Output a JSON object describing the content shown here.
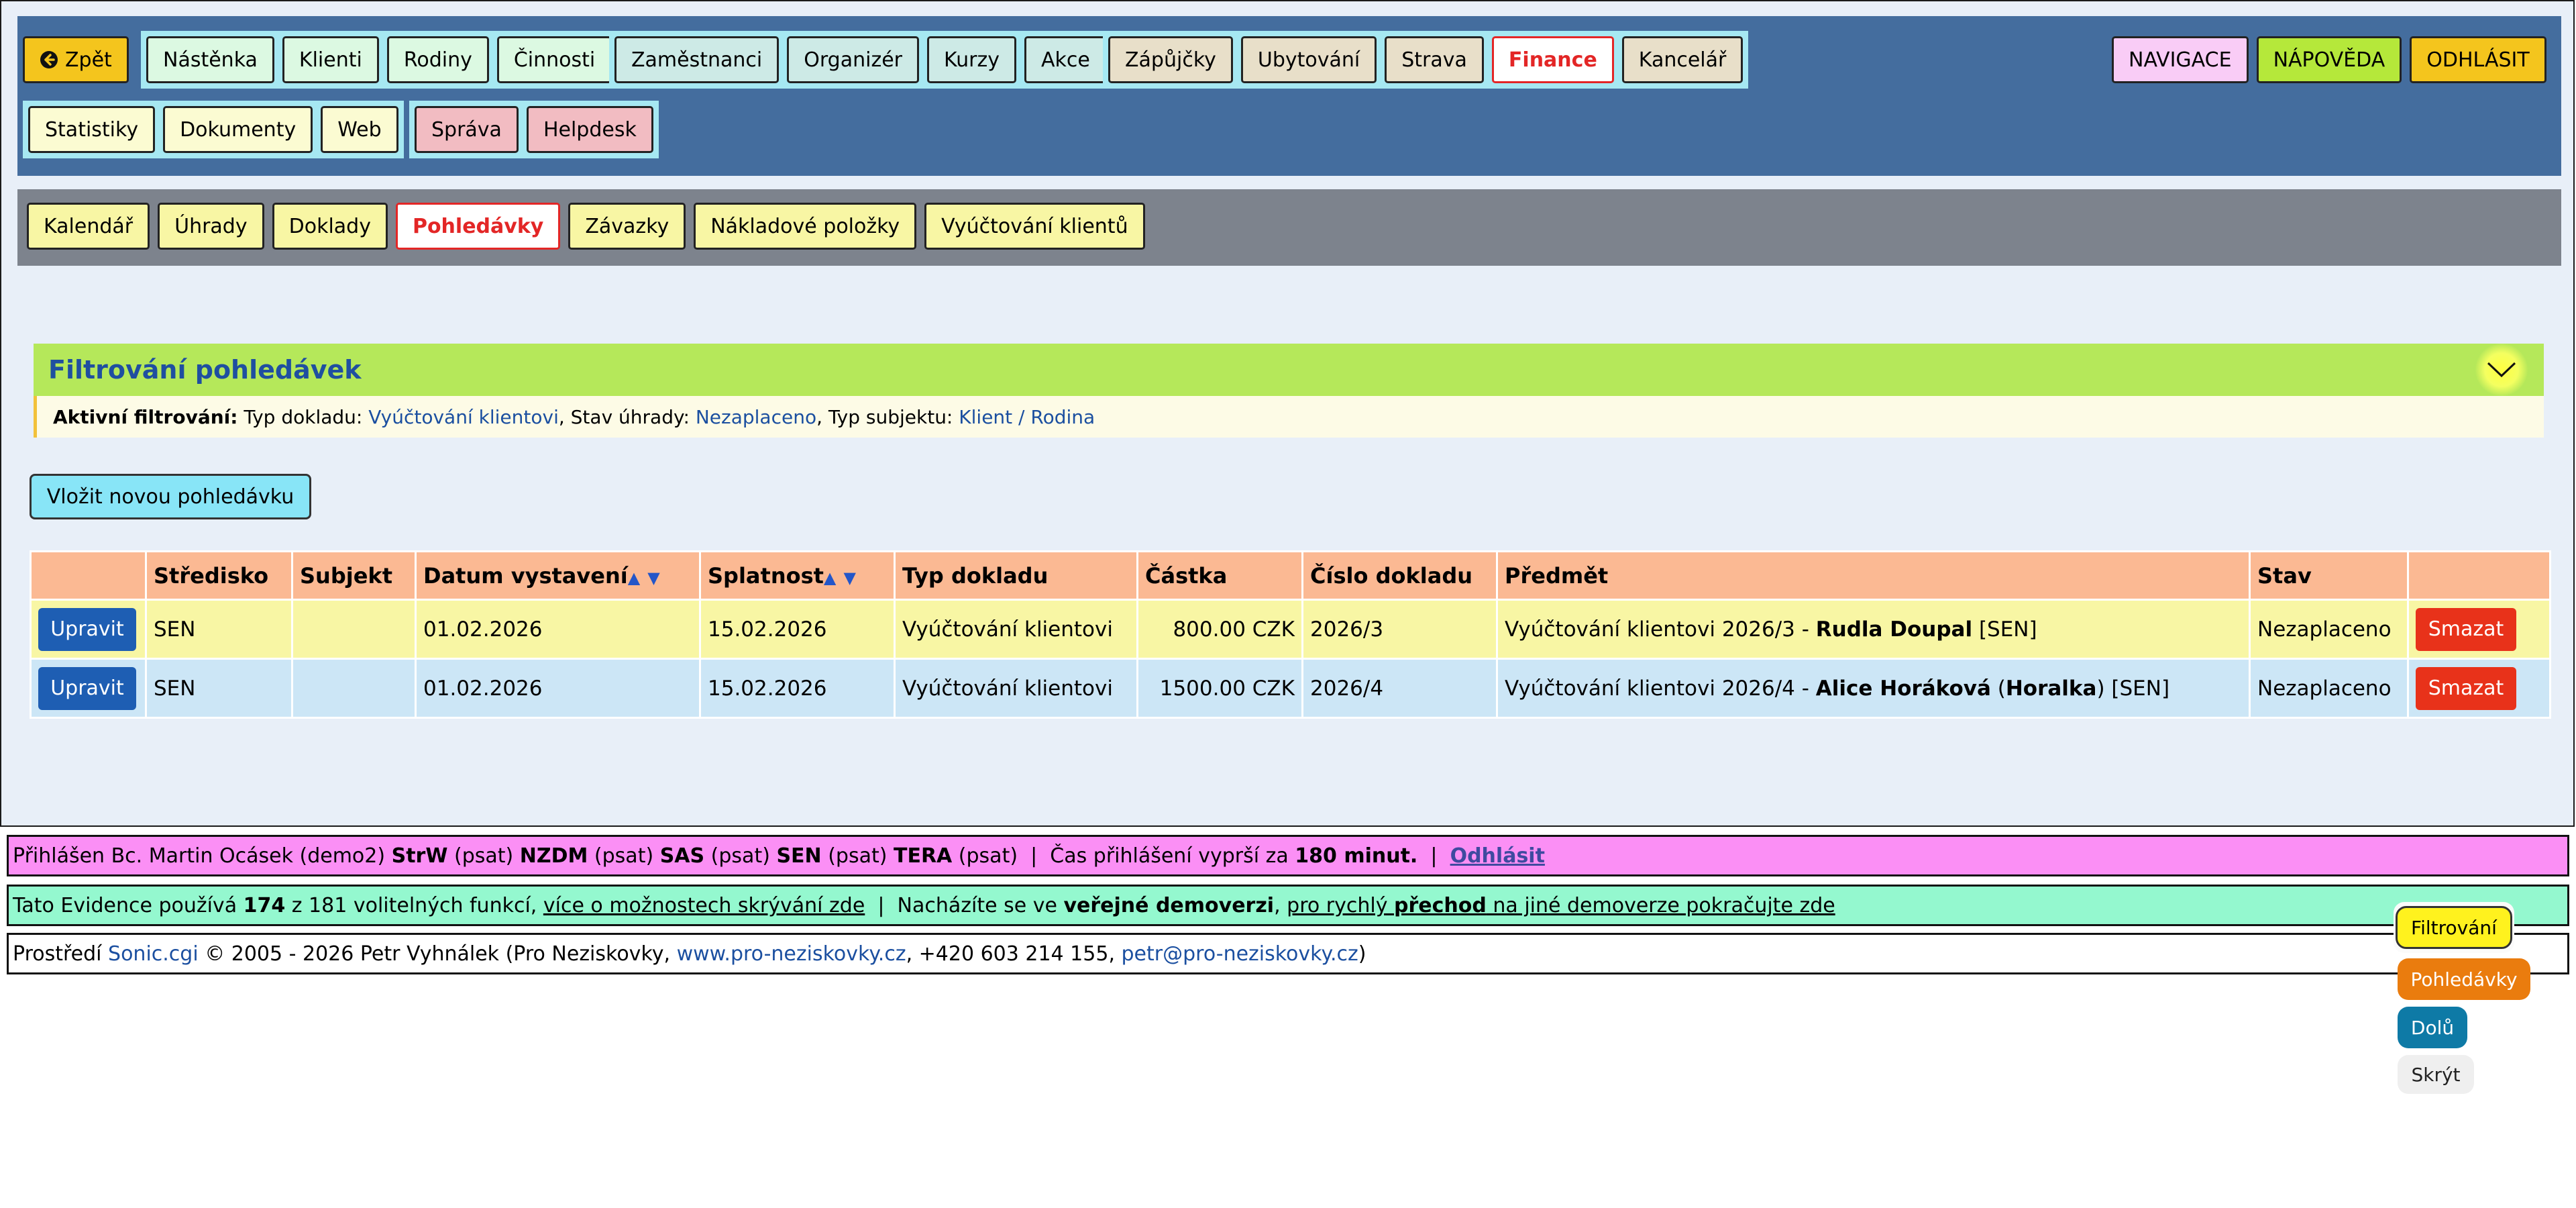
{
  "nav": {
    "back": "Zpět",
    "group1": [
      "Nástěnka",
      "Klienti",
      "Rodiny",
      "Činnosti"
    ],
    "group2": [
      "Zaměstnanci",
      "Organizér",
      "Kurzy",
      "Akce"
    ],
    "group3": [
      "Zápůjčky",
      "Ubytování",
      "Strava",
      "Finance",
      "Kancelář"
    ],
    "group4": [
      "Statistiky",
      "Dokumenty",
      "Web"
    ],
    "group5": [
      "Správa",
      "Helpdesk"
    ],
    "right": [
      "NAVIGACE",
      "NÁPOVĚDA",
      "ODHLÁSIT"
    ]
  },
  "subnav": [
    "Kalendář",
    "Úhrady",
    "Doklady",
    "Pohledávky",
    "Závazky",
    "Nákladové položky",
    "Vyúčtování klientů"
  ],
  "filter": {
    "title": "Filtrování pohledávek",
    "active_label": "Aktivní filtrování:",
    "parts": {
      "t1": " Typ dokladu: ",
      "v1": "Vyúčtování klientovi",
      "t2": ", Stav úhrady: ",
      "v2": "Nezaplaceno",
      "t3": ", Typ subjektu: ",
      "v3": "Klient / Rodina"
    }
  },
  "new_button": "Vložit novou pohledávku",
  "table": {
    "headers": [
      "",
      "Středisko",
      "Subjekt",
      "Datum vystavení",
      "Splatnost",
      "Typ dokladu",
      "Částka",
      "Číslo dokladu",
      "Předmět",
      "Stav",
      ""
    ],
    "sort_up": "▲",
    "sort_down": "▼",
    "edit_label": "Upravit",
    "delete_label": "Smazat",
    "rows": [
      {
        "stredisko": "SEN",
        "subjekt": "",
        "datum": "01.02.2026",
        "splatnost": "15.02.2026",
        "typ": "Vyúčtování klientovi",
        "castka": "800.00 CZK",
        "cislo": "2026/3",
        "predmet_a": "Vyúčtování klientovi 2026/3 - ",
        "predmet_b": "Rudla Doupal",
        "predmet_c": " [SEN]",
        "stav": "Nezaplaceno"
      },
      {
        "stredisko": "SEN",
        "subjekt": "",
        "datum": "01.02.2026",
        "splatnost": "15.02.2026",
        "typ": "Vyúčtování klientovi",
        "castka": "1500.00 CZK",
        "cislo": "2026/4",
        "predmet_a": "Vyúčtování klientovi 2026/4 - ",
        "predmet_b": "Alice Horáková",
        "predmet_c": " (",
        "predmet_d": "Horalka",
        "predmet_e": ") [SEN]",
        "stav": "Nezaplaceno"
      }
    ]
  },
  "footer": {
    "line1": {
      "a": "Přihlášen Bc. Martin Ocásek (demo2) ",
      "b1": "StrW",
      "c1": " (psat) ",
      "b2": "NZDM",
      "c2": " (psat) ",
      "b3": "SAS",
      "c3": " (psat) ",
      "b4": "SEN",
      "c4": " (psat) ",
      "b5": "TERA",
      "c5": " (psat)  |  Čas přihlášení vyprší za ",
      "b6": "180 minut.",
      "sep": "  |  ",
      "logout": "Odhlásit"
    },
    "line2": {
      "a": "Tato Evidence používá ",
      "b": "174",
      "c": " z 181 volitelných funkcí, ",
      "link1": "více o možnostech skrývání zde",
      "d": "  |  Nacházíte se ve ",
      "e": "veřejné demoverzi",
      "f": ", ",
      "link2a": "pro rychlý ",
      "link2b": "přechod",
      "link2c": " na jiné demoverze pokračujte zde"
    },
    "line3": {
      "a": "Prostředí ",
      "link1": "Sonic.cgi",
      "b": " © 2005 - 2026 Petr Vyhnálek (Pro Neziskovky, ",
      "link2": "www.pro-neziskovky.cz",
      "c": ", +420 603 214 155, ",
      "link3": "petr@pro-neziskovky.cz",
      "d": ")"
    }
  },
  "floating": [
    "Filtrování",
    "Pohledávky",
    "Dolů",
    "Skrýt"
  ],
  "colors": {
    "topbar": "#446d9e",
    "subbar": "#7d838d",
    "active_red": "#e32626",
    "filter_head": "#b5e85a",
    "table_head": "#fbb993",
    "row_even": "#f8f6a4",
    "row_odd": "#cce6f6"
  }
}
